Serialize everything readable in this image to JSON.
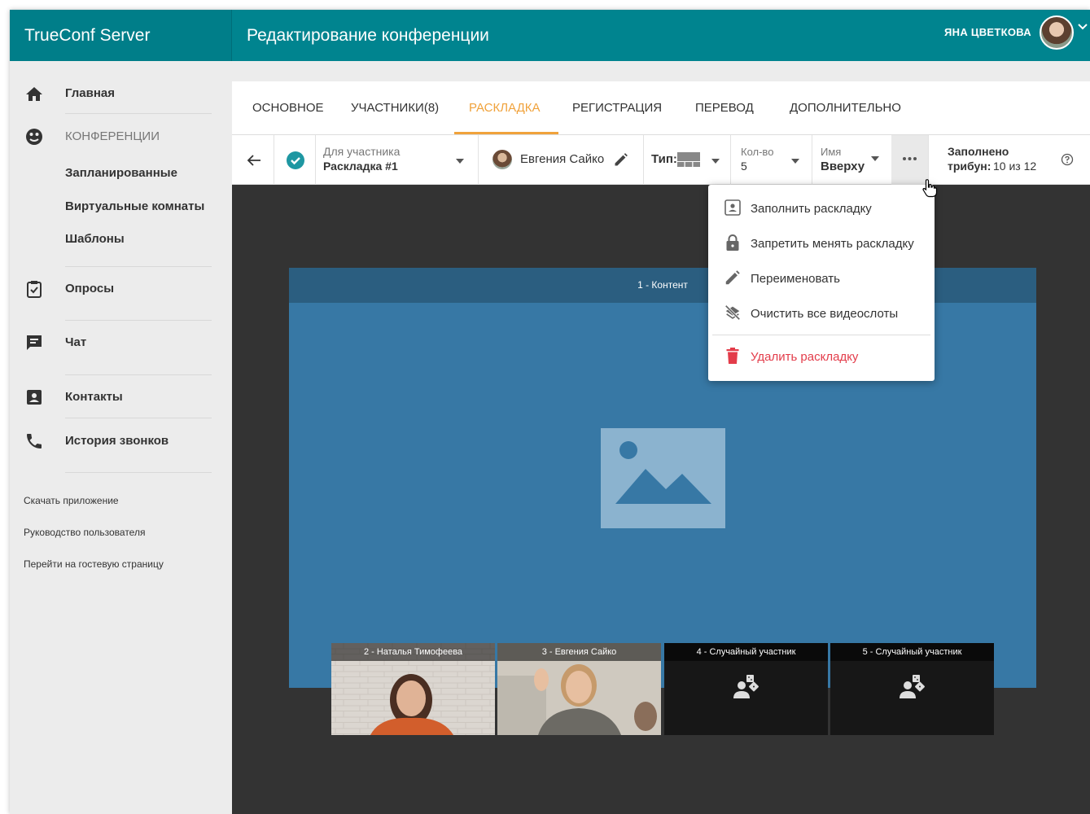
{
  "header": {
    "brand": "TrueConf Server",
    "title": "Редактирование конференции",
    "user_name": "ЯНА ЦВЕТКОВА"
  },
  "sidebar": {
    "home": "Главная",
    "conferences": "КОНФЕРЕНЦИИ",
    "scheduled": "Запланированные",
    "virtual_rooms": "Виртуальные комнаты",
    "templates": "Шаблоны",
    "polls": "Опросы",
    "chat": "Чат",
    "contacts": "Контакты",
    "call_history": "История звонков",
    "links": [
      "Скачать приложение",
      "Руководство пользователя",
      "Перейти на гостевую страницу"
    ]
  },
  "tabs": [
    "ОСНОВНОЕ",
    "УЧАСТНИКИ(8)",
    "РАСКЛАДКА",
    "РЕГИСТРАЦИЯ",
    "ПЕРЕВОД",
    "ДОПОЛНИТЕЛЬНО"
  ],
  "active_tab": "РАСКЛАДКА",
  "toolbar": {
    "for_label": "Для участника",
    "layout_name": "Раскладка #1",
    "participant": "Евгения Сайко",
    "type_label": "Тип:",
    "count_label": "Кол-во",
    "count_value": "5",
    "name_label": "Имя",
    "name_value": "Вверху",
    "filled_label": "Заполнено",
    "tribunes_label": "трибун:",
    "tribunes_value": "10 из 12"
  },
  "menu": {
    "fill": "Заполнить раскладку",
    "lock": "Запретить менять раскладку",
    "rename": "Переименовать",
    "clear": "Очистить все видеослоты",
    "delete": "Удалить раскладку"
  },
  "layout": {
    "content_label": "1 - Контент",
    "slots": [
      "2 - Наталья Тимофеева",
      "3 - Евгения Сайко",
      "4 - Случайный участник",
      "5 - Случайный участник"
    ]
  },
  "colors": {
    "header": "#00848f",
    "accent": "#f0a23b",
    "danger": "#e33c4a",
    "check": "#1e97a2"
  }
}
